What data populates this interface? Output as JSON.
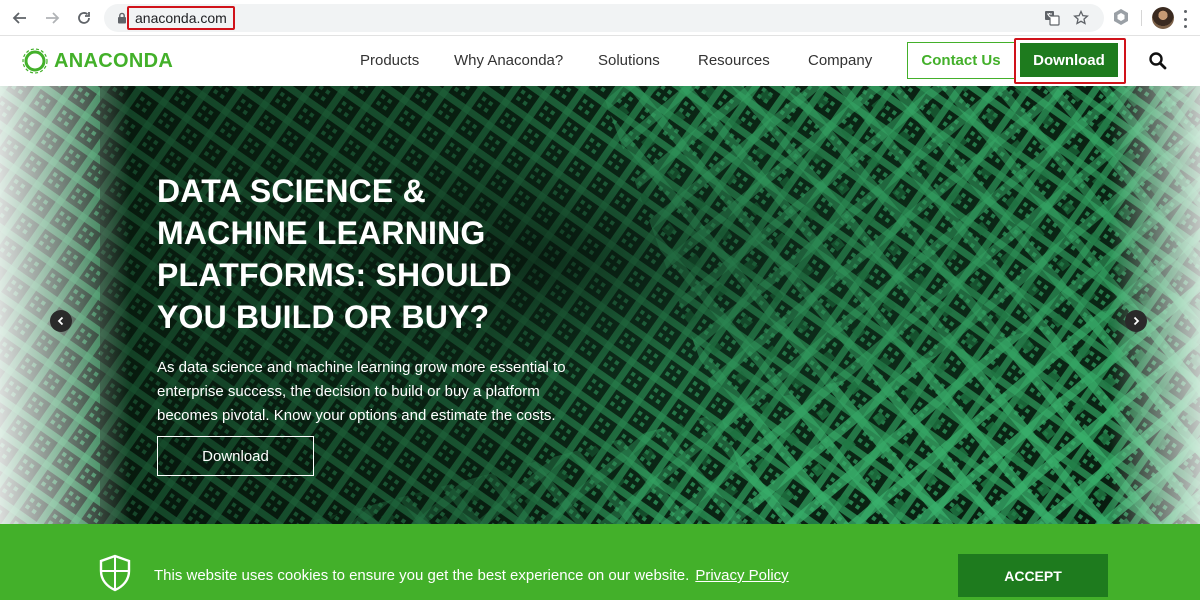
{
  "browser": {
    "url": "anaconda.com",
    "icons": [
      "back-arrow-icon",
      "forward-arrow-icon",
      "reload-icon",
      "lock-icon",
      "translate-icon",
      "star-icon",
      "extension-icon",
      "profile-avatar",
      "menu-kebab-icon"
    ]
  },
  "header": {
    "logo_text": "ANACONDA",
    "nav": [
      "Products",
      "Why Anaconda?",
      "Solutions",
      "Resources",
      "Company"
    ],
    "contact_label": "Contact Us",
    "download_label": "Download"
  },
  "hero": {
    "title": "DATA SCIENCE & MACHINE LEARNING PLATFORMS: SHOULD YOU BUILD OR BUY?",
    "body": "As data science and machine learning grow more essential to enterprise success, the decision to build or buy a platform becomes pivotal. Know your options and estimate the costs.",
    "button_label": "Download"
  },
  "cookie": {
    "text": "This website uses cookies to ensure you get the best experience on our website.",
    "link_label": "Privacy Policy",
    "accept_label": "ACCEPT"
  },
  "colors": {
    "brand_green": "#43b02a",
    "dark_green": "#1e7b1e",
    "highlight_red": "#d0121a"
  }
}
